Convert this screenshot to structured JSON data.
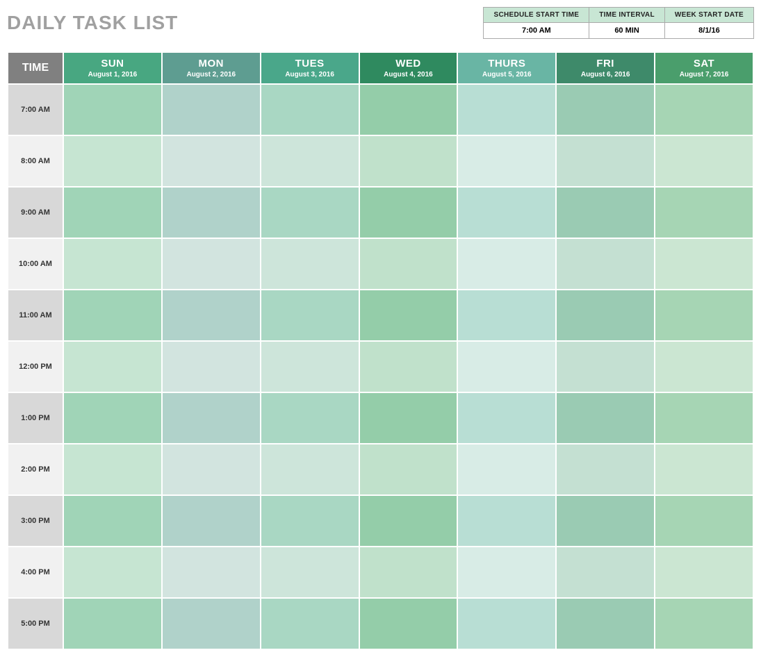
{
  "title": "DAILY TASK LIST",
  "settings": {
    "headers": [
      "SCHEDULE START TIME",
      "TIME INTERVAL",
      "WEEK START DATE"
    ],
    "values": [
      "7:00 AM",
      "60 MIN",
      "8/1/16"
    ]
  },
  "time_label": "TIME",
  "days": [
    {
      "abbr": "SUN",
      "date": "August 1, 2016"
    },
    {
      "abbr": "MON",
      "date": "August 2, 2016"
    },
    {
      "abbr": "TUES",
      "date": "August 3, 2016"
    },
    {
      "abbr": "WED",
      "date": "August 4, 2016"
    },
    {
      "abbr": "THURS",
      "date": "August 5, 2016"
    },
    {
      "abbr": "FRI",
      "date": "August 6, 2016"
    },
    {
      "abbr": "SAT",
      "date": "August 7, 2016"
    }
  ],
  "times": [
    "7:00 AM",
    "8:00 AM",
    "9:00 AM",
    "10:00 AM",
    "11:00 AM",
    "12:00 PM",
    "1:00 PM",
    "2:00 PM",
    "3:00 PM",
    "4:00 PM",
    "5:00 PM"
  ]
}
